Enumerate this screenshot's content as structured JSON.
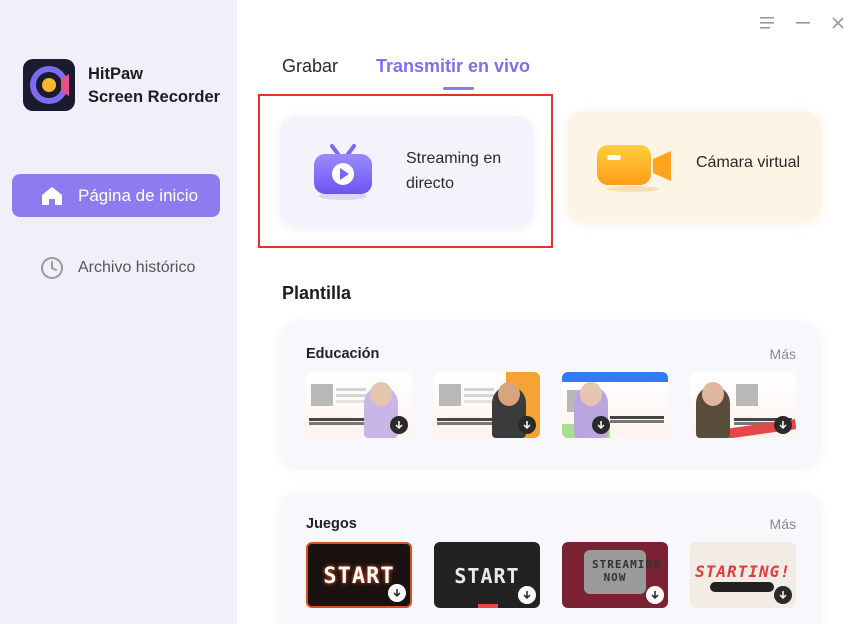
{
  "app": {
    "name_line1": "HitPaw",
    "name_line2": "Screen Recorder"
  },
  "sidebar": {
    "items": [
      {
        "label": "Página de inicio",
        "icon": "home-icon",
        "active": true
      },
      {
        "label": "Archivo histórico",
        "icon": "clock-icon",
        "active": false
      }
    ]
  },
  "window": {
    "controls": [
      "menu-icon",
      "minimize-icon",
      "close-icon"
    ]
  },
  "tabs": [
    {
      "label": "Grabar",
      "active": false
    },
    {
      "label": "Transmitir en vivo",
      "active": true
    }
  ],
  "features": {
    "streaming": {
      "label": "Streaming en directo",
      "icon": "tv-play-icon"
    },
    "virtual_camera": {
      "label": "Cámara virtual",
      "icon": "camera-icon"
    }
  },
  "templates": {
    "title": "Plantilla",
    "more_label": "Más",
    "categories": [
      {
        "name": "Educación"
      },
      {
        "name": "Juegos"
      }
    ],
    "games": [
      "START",
      "START",
      "STREAMING NOW",
      "STARTING!"
    ]
  },
  "colors": {
    "accent": "#8c7cf0",
    "highlight": "#e8302a",
    "sidebar_bg": "#f1effa"
  }
}
